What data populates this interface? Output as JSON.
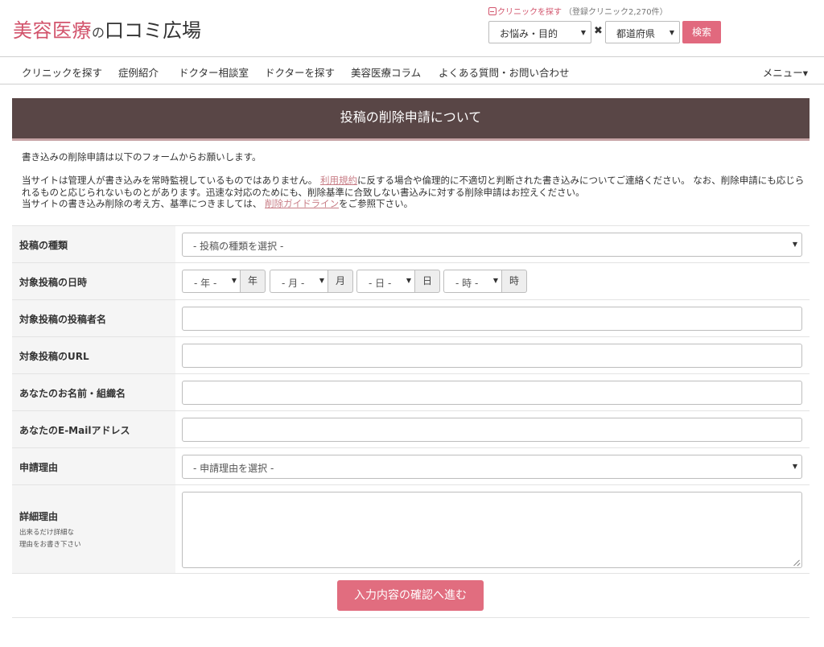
{
  "header": {
    "logo_part1": "美容医療",
    "logo_part2": "の",
    "logo_part3": "口コミ広場",
    "find_clinic_link": "クリニックを探す",
    "clinic_count": "（登録クリニック2,270件）",
    "concern_select": "お悩み・目的",
    "times_symbol": "✖",
    "prefecture_select": "都道府県",
    "search_button": "検索"
  },
  "nav": {
    "items": [
      "クリニックを探す",
      "症例紹介",
      "ドクター相談室",
      "ドクターを探す",
      "美容医療コラム",
      "よくある質問・お問い合わせ"
    ],
    "menu": "メニュー▾"
  },
  "page": {
    "title": "投稿の削除申請について"
  },
  "intro": {
    "line1": "書き込みの削除申請は以下のフォームからお願いします。",
    "p2_a": "当サイトは管理人が書き込みを常時監視しているものではありません。",
    "p2_link": "利用規約",
    "p2_b": "に反する場合や倫理的に不適切と判断された書き込みについてご連絡ください。 なお、削除申請にも応じられるものと応じられないものとがあります。迅速な対応のためにも、削除基準に合致しない書込みに対する削除申請はお控えください。",
    "p3_a": "当サイトの書き込み削除の考え方、基準につきましては、",
    "p3_link": "削除ガイドライン",
    "p3_b": "をご参照下さい。"
  },
  "form": {
    "post_type": {
      "label": "投稿の種類",
      "placeholder": "- 投稿の種類を選択 -"
    },
    "post_datetime": {
      "label": "対象投稿の日時",
      "year": "- 年 -",
      "year_unit": "年",
      "month": "- 月 -",
      "month_unit": "月",
      "day": "- 日 -",
      "day_unit": "日",
      "hour": "- 時 -",
      "hour_unit": "時"
    },
    "poster_name": {
      "label": "対象投稿の投稿者名",
      "value": ""
    },
    "post_url": {
      "label": "対象投稿のURL",
      "value": ""
    },
    "your_name": {
      "label": "あなたのお名前・組織名",
      "value": ""
    },
    "email": {
      "label": "あなたのE-Mailアドレス",
      "value": ""
    },
    "reason": {
      "label": "申請理由",
      "placeholder": "- 申請理由を選択 -"
    },
    "detail": {
      "label": "詳細理由",
      "sub1": "出来るだけ詳細な",
      "sub2": "理由をお書き下さい",
      "value": ""
    },
    "submit": "入力内容の確認へ進む"
  },
  "icons": {
    "caret": "▼"
  },
  "colors": {
    "brand_pink": "#d2546c",
    "title_bar": "#594646",
    "title_bar_border": "#c7a4a6",
    "button_pink": "#e16d7f",
    "link": "#c87d86"
  }
}
